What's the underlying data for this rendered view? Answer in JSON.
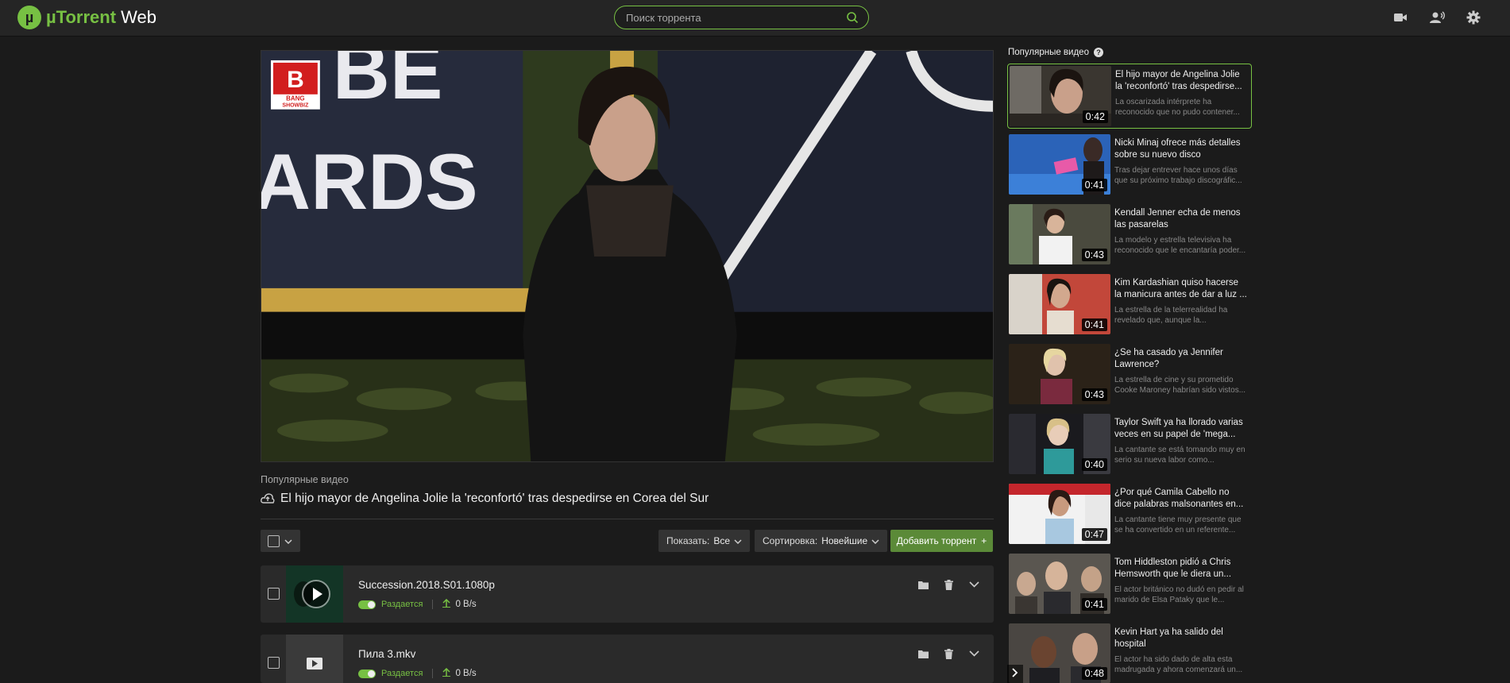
{
  "app": {
    "brand": "µTorrent",
    "suffix": " Web",
    "logo_glyph": "µ",
    "accent_color": "#77c043"
  },
  "search": {
    "placeholder": "Поиск торрента",
    "icon": "search-icon"
  },
  "top_icons": [
    "video-camera-icon",
    "users-icon",
    "gear-icon"
  ],
  "player": {
    "category": "Популярные видео",
    "title": "El hijo mayor de Angelina Jolie la 'reconfortó' tras despedirse en Corea del Sur",
    "channel_logo_lines": [
      "BANG",
      "SHOWBIZ"
    ],
    "backdrop_letters": "BE ARDS"
  },
  "toolbar": {
    "show_label": "Показать:",
    "show_value": "Все",
    "sort_label": "Сортировка:",
    "sort_value": "Новейшие",
    "add_label": "Добавить торрент",
    "add_symbol": "+"
  },
  "torrents": [
    {
      "name": "Succession.2018.S01.1080p",
      "status": "Раздается",
      "speed": "0 B/s"
    },
    {
      "name": "Пила 3.mkv",
      "status": "Раздается",
      "speed": "0 B/s"
    }
  ],
  "sidebar": {
    "heading": "Популярные видео",
    "help": "?",
    "items": [
      {
        "title": "El hijo mayor de Angelina Jolie la 'reconfortó' tras despedirse...",
        "desc": "La oscarizada intérprete ha reconocido que no pudo contener...",
        "duration": "0:42"
      },
      {
        "title": "Nicki Minaj ofrece más detalles sobre su nuevo disco",
        "desc": "Tras dejar entrever hace unos días que su próximo trabajo discográfic...",
        "duration": "0:41"
      },
      {
        "title": "Kendall Jenner echa de menos las pasarelas",
        "desc": "La modelo y estrella televisiva ha reconocido que le encantaría poder...",
        "duration": "0:43"
      },
      {
        "title": "Kim Kardashian quiso hacerse la manicura antes de dar a luz ...",
        "desc": "La estrella de la telerrealidad ha revelado que, aunque la...",
        "duration": "0:41"
      },
      {
        "title": "¿Se ha casado ya Jennifer Lawrence?",
        "desc": "La estrella de cine y su prometido Cooke Maroney habrían sido vistos...",
        "duration": "0:43"
      },
      {
        "title": "Taylor Swift ya ha llorado varias veces en su papel de 'mega...",
        "desc": "La cantante se está tomando muy en serio su nueva labor como...",
        "duration": "0:40"
      },
      {
        "title": "¿Por qué Camila Cabello no dice palabras malsonantes en...",
        "desc": "La cantante tiene muy presente que se ha convertido en un referente...",
        "duration": "0:47"
      },
      {
        "title": "Tom Hiddleston pidió a Chris Hemsworth que le diera un...",
        "desc": "El actor británico no dudó en pedir al marido de Elsa Pataky que le...",
        "duration": "0:41"
      },
      {
        "title": "Kevin Hart ya ha salido del hospital",
        "desc": "El actor ha sido dado de alta esta madrugada y ahora comenzará un...",
        "duration": "0:48"
      }
    ]
  }
}
